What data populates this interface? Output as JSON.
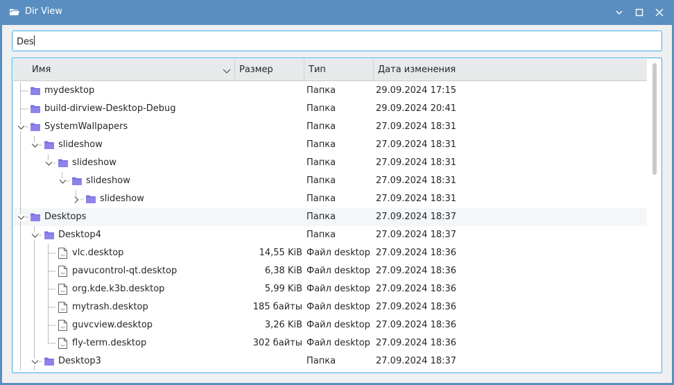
{
  "window": {
    "title": "Dir View",
    "app_icon": "folder-open-icon"
  },
  "titlebar_buttons": [
    {
      "name": "minimize",
      "icon": "minimize-icon"
    },
    {
      "name": "maximize",
      "icon": "maximize-icon"
    },
    {
      "name": "close",
      "icon": "close-icon"
    }
  ],
  "search": {
    "value": "Des",
    "placeholder": ""
  },
  "columns": {
    "name": "Имя",
    "size": "Размер",
    "type": "Тип",
    "date": "Дата изменения",
    "sort_icon": "chevron-down-icon"
  },
  "colors": {
    "titlebar": "#5a8ec0",
    "accent": "#3daee9",
    "folder": "#7b6fe0"
  },
  "rows": [
    {
      "depth": 0,
      "kind": "folder",
      "expander": "none",
      "name": "mydesktop",
      "size": "",
      "type": "Папка",
      "date": "29.09.2024 17:15"
    },
    {
      "depth": 0,
      "kind": "folder",
      "expander": "none",
      "name": "build-dirview-Desktop-Debug",
      "size": "",
      "type": "Папка",
      "date": "29.09.2024 20:41"
    },
    {
      "depth": 0,
      "kind": "folder",
      "expander": "open",
      "name": "SystemWallpapers",
      "size": "",
      "type": "Папка",
      "date": "27.09.2024 18:31"
    },
    {
      "depth": 1,
      "kind": "folder",
      "expander": "open",
      "name": "slideshow",
      "size": "",
      "type": "Папка",
      "date": "27.09.2024 18:31"
    },
    {
      "depth": 2,
      "kind": "folder",
      "expander": "open",
      "name": "slideshow",
      "size": "",
      "type": "Папка",
      "date": "27.09.2024 18:31"
    },
    {
      "depth": 3,
      "kind": "folder",
      "expander": "open",
      "name": "slideshow",
      "size": "",
      "type": "Папка",
      "date": "27.09.2024 18:31"
    },
    {
      "depth": 4,
      "kind": "folder",
      "expander": "closed",
      "name": "slideshow",
      "size": "",
      "type": "Папка",
      "date": "27.09.2024 18:31"
    },
    {
      "depth": 0,
      "kind": "folder",
      "expander": "open",
      "name": "Desktops",
      "size": "",
      "type": "Папка",
      "date": "27.09.2024 18:37",
      "highlight": true
    },
    {
      "depth": 1,
      "kind": "folder",
      "expander": "open",
      "name": "Desktop4",
      "size": "",
      "type": "Папка",
      "date": "27.09.2024 18:37"
    },
    {
      "depth": 2,
      "kind": "file",
      "expander": "none",
      "name": "vlc.desktop",
      "size": "14,55 KiB",
      "type": "Файл desktop",
      "date": "27.09.2024 18:36"
    },
    {
      "depth": 2,
      "kind": "file",
      "expander": "none",
      "name": "pavucontrol-qt.desktop",
      "size": "6,38 KiB",
      "type": "Файл desktop",
      "date": "27.09.2024 18:36"
    },
    {
      "depth": 2,
      "kind": "file",
      "expander": "none",
      "name": "org.kde.k3b.desktop",
      "size": "5,99 KiB",
      "type": "Файл desktop",
      "date": "27.09.2024 18:36"
    },
    {
      "depth": 2,
      "kind": "file",
      "expander": "none",
      "name": "mytrash.desktop",
      "size": "185 байты",
      "type": "Файл desktop",
      "date": "27.09.2024 18:36"
    },
    {
      "depth": 2,
      "kind": "file",
      "expander": "none",
      "name": "guvcview.desktop",
      "size": "3,26 KiB",
      "type": "Файл desktop",
      "date": "27.09.2024 18:36"
    },
    {
      "depth": 2,
      "kind": "file",
      "expander": "none",
      "name": "fly-term.desktop",
      "size": "302 байты",
      "type": "Файл desktop",
      "date": "27.09.2024 18:36"
    },
    {
      "depth": 1,
      "kind": "folder",
      "expander": "open",
      "name": "Desktop3",
      "size": "",
      "type": "Папка",
      "date": "27.09.2024 18:37"
    }
  ]
}
